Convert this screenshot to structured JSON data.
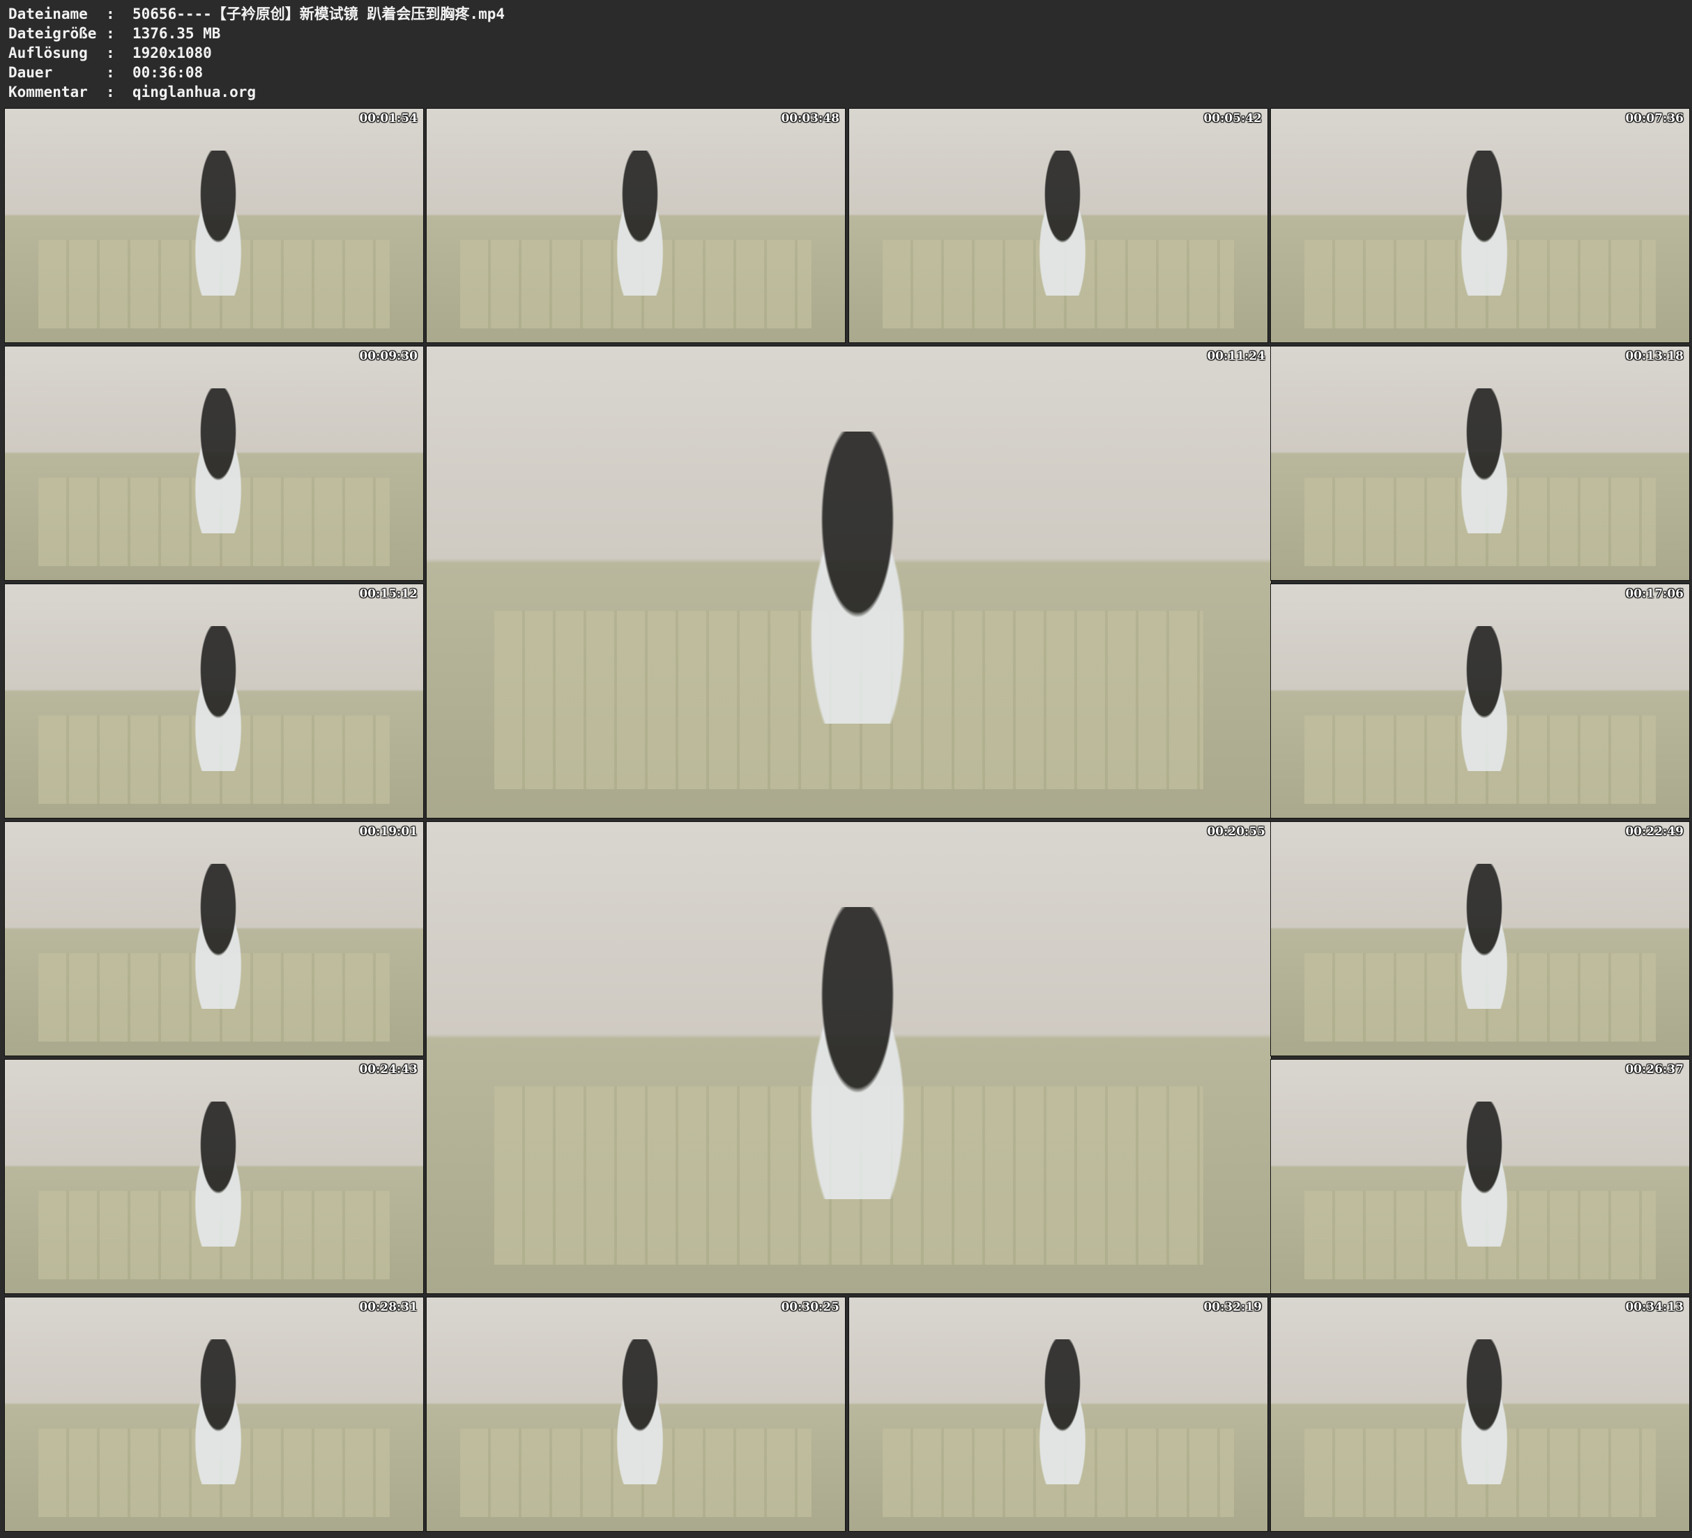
{
  "header": {
    "rows": [
      {
        "label": "Dateiname",
        "separator": ":",
        "value": "50656----【子衿原创】新模试镜 趴着会压到胸疼.mp4"
      },
      {
        "label": "Dateigröße",
        "separator": ":",
        "value": "1376.35 MB"
      },
      {
        "label": "Auflösung",
        "separator": ":",
        "value": "1920x1080"
      },
      {
        "label": "Dauer",
        "separator": ":",
        "value": "00:36:08"
      },
      {
        "label": "Kommentar",
        "separator": ":",
        "value": "qinglanhua.org"
      }
    ]
  },
  "thumbnails": [
    {
      "timestamp": "00:01:54"
    },
    {
      "timestamp": "00:03:48"
    },
    {
      "timestamp": "00:05:42"
    },
    {
      "timestamp": "00:07:36"
    },
    {
      "timestamp": "00:09:30"
    },
    {
      "timestamp": "00:11:24"
    },
    {
      "timestamp": "00:13:18"
    },
    {
      "timestamp": "00:15:12"
    },
    {
      "timestamp": "00:17:06"
    },
    {
      "timestamp": "00:19:01"
    },
    {
      "timestamp": "00:20:55"
    },
    {
      "timestamp": "00:22:49"
    },
    {
      "timestamp": "00:24:43"
    },
    {
      "timestamp": "00:26:37"
    },
    {
      "timestamp": "00:28:31"
    },
    {
      "timestamp": "00:30:25"
    },
    {
      "timestamp": "00:32:19"
    },
    {
      "timestamp": "00:34:13"
    }
  ]
}
